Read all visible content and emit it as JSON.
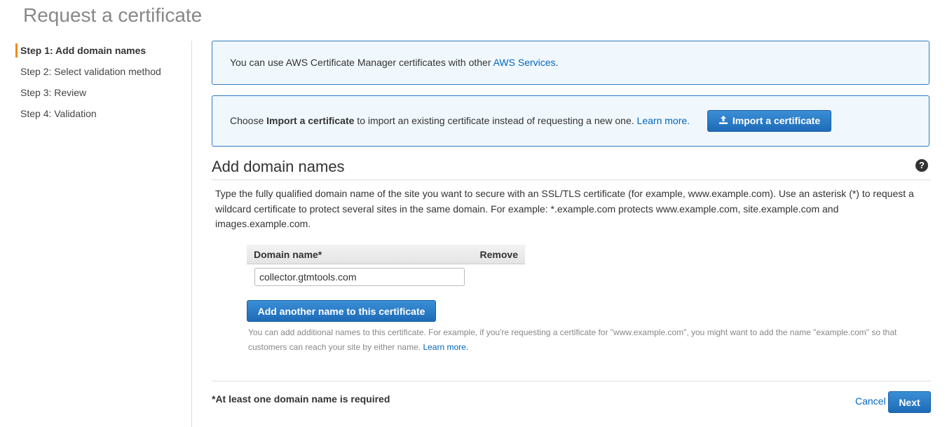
{
  "page": {
    "title": "Request a certificate"
  },
  "steps": [
    {
      "label": "Step 1: Add domain names"
    },
    {
      "label": "Step 2: Select validation method"
    },
    {
      "label": "Step 3: Review"
    },
    {
      "label": "Step 4: Validation"
    }
  ],
  "info_services": {
    "text": "You can use AWS Certificate Manager certificates with other ",
    "link": "AWS Services",
    "suffix": "."
  },
  "info_import": {
    "text_prefix": "Choose ",
    "bold": "Import a certificate",
    "text_suffix": " to import an existing certificate instead of requesting a new one. ",
    "link": "Learn more.",
    "button_label": "Import a certificate",
    "button_icon": "upload-icon"
  },
  "section": {
    "title": "Add domain names",
    "help_icon": "help-icon",
    "help_glyph": "?",
    "description": "Type the fully qualified domain name of the site you want to secure with an SSL/TLS certificate (for example, www.example.com). Use an asterisk (*) to request a wildcard certificate to protect several sites in the same domain. For example: *.example.com protects www.example.com, site.example.com and images.example.com."
  },
  "domain_table": {
    "columns": [
      "Domain name*",
      "Remove"
    ],
    "rows": [
      {
        "value": "collector.gtmtools.com"
      }
    ]
  },
  "add_button": {
    "label": "Add another name to this certificate"
  },
  "hint": {
    "text": "You can add additional names to this certificate. For example, if you're requesting a certificate for \"www.example.com\", you might want to add the name \"example.com\" so that customers can reach your site by either name. ",
    "link": "Learn more."
  },
  "footer": {
    "required_note": "*At least one domain name is required",
    "cancel": "Cancel",
    "next": "Next"
  },
  "colors": {
    "accent_blue": "#2e7bc1",
    "link": "#0066c0",
    "step_marker": "#f08c00"
  }
}
